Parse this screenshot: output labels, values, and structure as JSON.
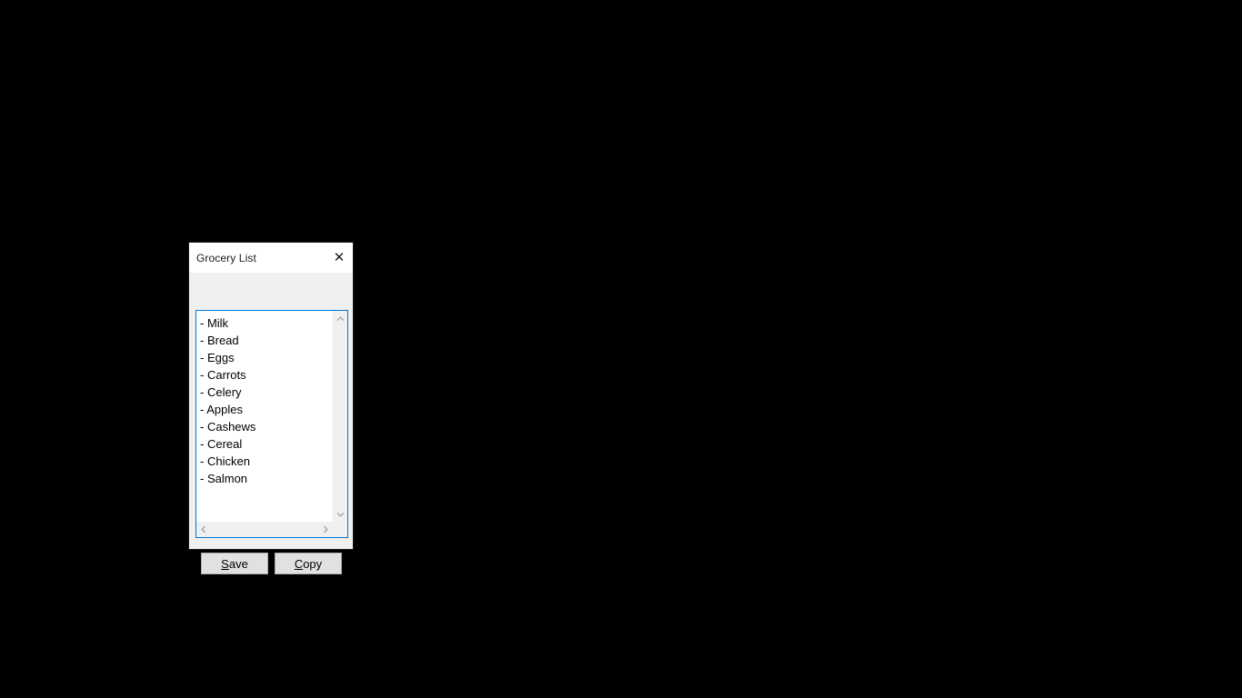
{
  "desktop": {
    "background_color": "#000000"
  },
  "window": {
    "title": "Grocery List",
    "close_icon": "close-icon",
    "close_glyph": "✕",
    "accent_color": "#0078d7",
    "body_color": "#f0f0f0",
    "titlebar_color": "#ffffff",
    "border_color": "#1a1a1a"
  },
  "list": {
    "bullet": "- ",
    "items": [
      "Milk",
      "Bread",
      "Eggs",
      "Carrots",
      "Celery",
      "Apples",
      "Cashews",
      "Cereal",
      "Chicken",
      "Salmon"
    ]
  },
  "scrollbars": {
    "vertical": {
      "up_arrow": "chevron-up-icon",
      "down_arrow": "chevron-down-icon"
    },
    "horizontal": {
      "left_arrow": "chevron-left-icon",
      "right_arrow": "chevron-right-icon"
    }
  },
  "buttons": {
    "save": {
      "mnemonic": "S",
      "rest": "ave"
    },
    "copy": {
      "mnemonic": "C",
      "rest": "opy"
    }
  }
}
